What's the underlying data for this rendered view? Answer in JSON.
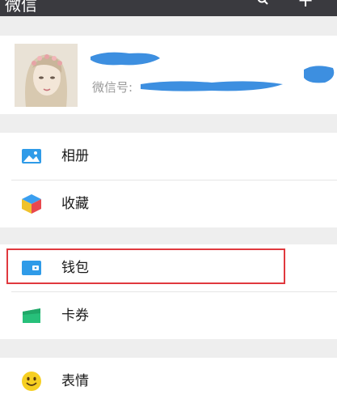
{
  "topbar": {
    "title": "微信",
    "search_icon": "search-icon",
    "plus_icon": "plus-icon",
    "background_color": "#3a3a3f"
  },
  "profile": {
    "wechat_id_label": "微信号:",
    "redaction_color": "#3d8fe0"
  },
  "menu": {
    "group1": [
      {
        "label": "相册",
        "icon": "album-icon"
      },
      {
        "label": "收藏",
        "icon": "favorites-icon"
      }
    ],
    "group2": [
      {
        "label": "钱包",
        "icon": "wallet-icon"
      },
      {
        "label": "卡券",
        "icon": "card-coupon-icon"
      }
    ],
    "group3": [
      {
        "label": "表情",
        "icon": "sticker-icon"
      }
    ]
  },
  "highlight": {
    "target": "钱包",
    "color": "#e0393e"
  }
}
